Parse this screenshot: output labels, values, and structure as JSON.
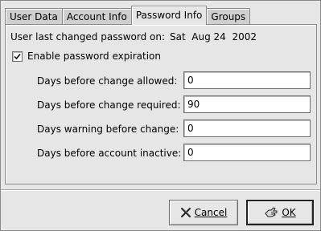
{
  "tabs": [
    {
      "label": "User Data",
      "active": false
    },
    {
      "label": "Account Info",
      "active": false
    },
    {
      "label": "Password Info",
      "active": true
    },
    {
      "label": "Groups",
      "active": false
    }
  ],
  "password_info": {
    "last_changed_label": "User last changed password on:",
    "last_changed_date": "Sat  Aug 24  2002",
    "enable_expiration": {
      "label": "Enable password expiration",
      "checked": true
    },
    "fields": [
      {
        "label": "Days before change allowed:",
        "value": "0"
      },
      {
        "label": "Days before change required:",
        "value": "90"
      },
      {
        "label": "Days warning before change:",
        "value": "0"
      },
      {
        "label": "Days before account inactive:",
        "value": "0"
      }
    ]
  },
  "buttons": {
    "cancel": {
      "label": "Cancel",
      "icon": "cancel-x-icon"
    },
    "ok": {
      "label": "OK",
      "icon": "ok-hand-icon"
    }
  }
}
